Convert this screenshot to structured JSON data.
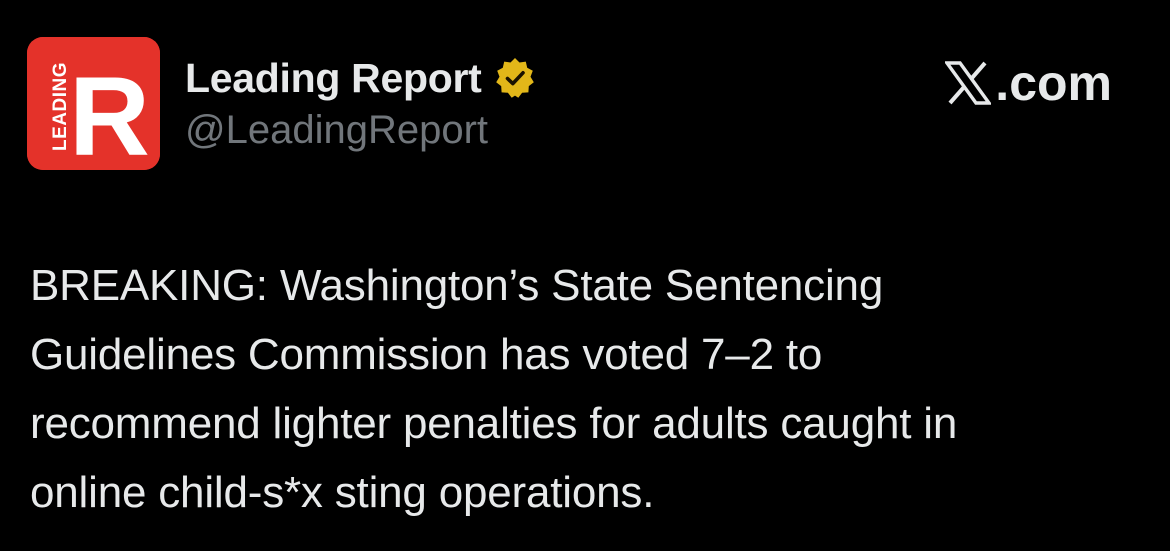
{
  "author": {
    "display_name": "Leading Report",
    "handle": "@LeadingReport",
    "verified": true,
    "avatar": {
      "letter": "R",
      "vertical_text": "LEADING",
      "background_color": "#e4322a"
    }
  },
  "source": {
    "brand_text": ".com",
    "icon": "x-logo-icon"
  },
  "post": {
    "lines": [
      "BREAKING: Washington’s State Sentencing",
      "Guidelines Commission has voted 7–2 to",
      "recommend lighter penalties for adults caught in",
      "online child-s*x sting operations."
    ]
  },
  "colors": {
    "background": "#000000",
    "text_primary": "#e7e9ea",
    "text_secondary": "#71767b",
    "badge_gold": "#e2b719"
  }
}
